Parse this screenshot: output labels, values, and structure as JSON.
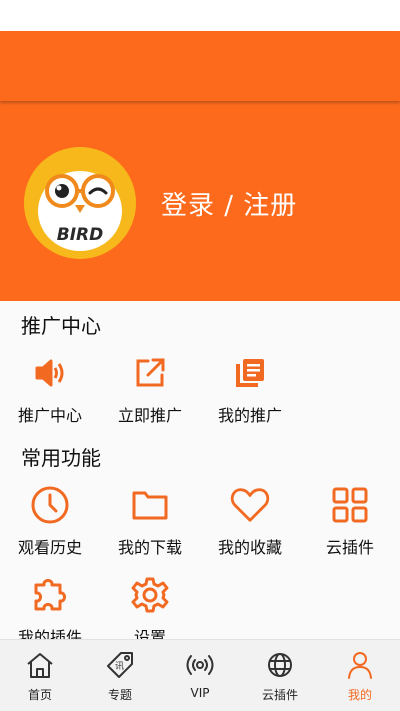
{
  "colors": {
    "brand": "#fd6a1c",
    "icon": "#f26a21",
    "nav_active": "#f26a21"
  },
  "header": {
    "login_text": "登录 / 注册",
    "avatar_text": "BIRD"
  },
  "promo": {
    "title": "推广中心",
    "items": [
      {
        "label": "推广中心",
        "icon": "speaker-icon"
      },
      {
        "label": "立即推广",
        "icon": "share-icon"
      },
      {
        "label": "我的推广",
        "icon": "document-icon"
      }
    ]
  },
  "common": {
    "title": "常用功能",
    "items": [
      {
        "label": "观看历史",
        "icon": "clock-icon"
      },
      {
        "label": "我的下载",
        "icon": "folder-icon"
      },
      {
        "label": "我的收藏",
        "icon": "heart-icon"
      },
      {
        "label": "云插件",
        "icon": "grid-icon"
      },
      {
        "label": "我的插件",
        "icon": "puzzle-icon"
      },
      {
        "label": "设置",
        "icon": "gear-icon"
      }
    ]
  },
  "nav": {
    "items": [
      {
        "label": "首页",
        "icon": "home-icon"
      },
      {
        "label": "专题",
        "icon": "tag-icon",
        "tag_text": "讯"
      },
      {
        "label": "VIP",
        "icon": "broadcast-icon"
      },
      {
        "label": "云插件",
        "icon": "globe-icon"
      },
      {
        "label": "我的",
        "icon": "user-icon",
        "active": true
      }
    ]
  }
}
